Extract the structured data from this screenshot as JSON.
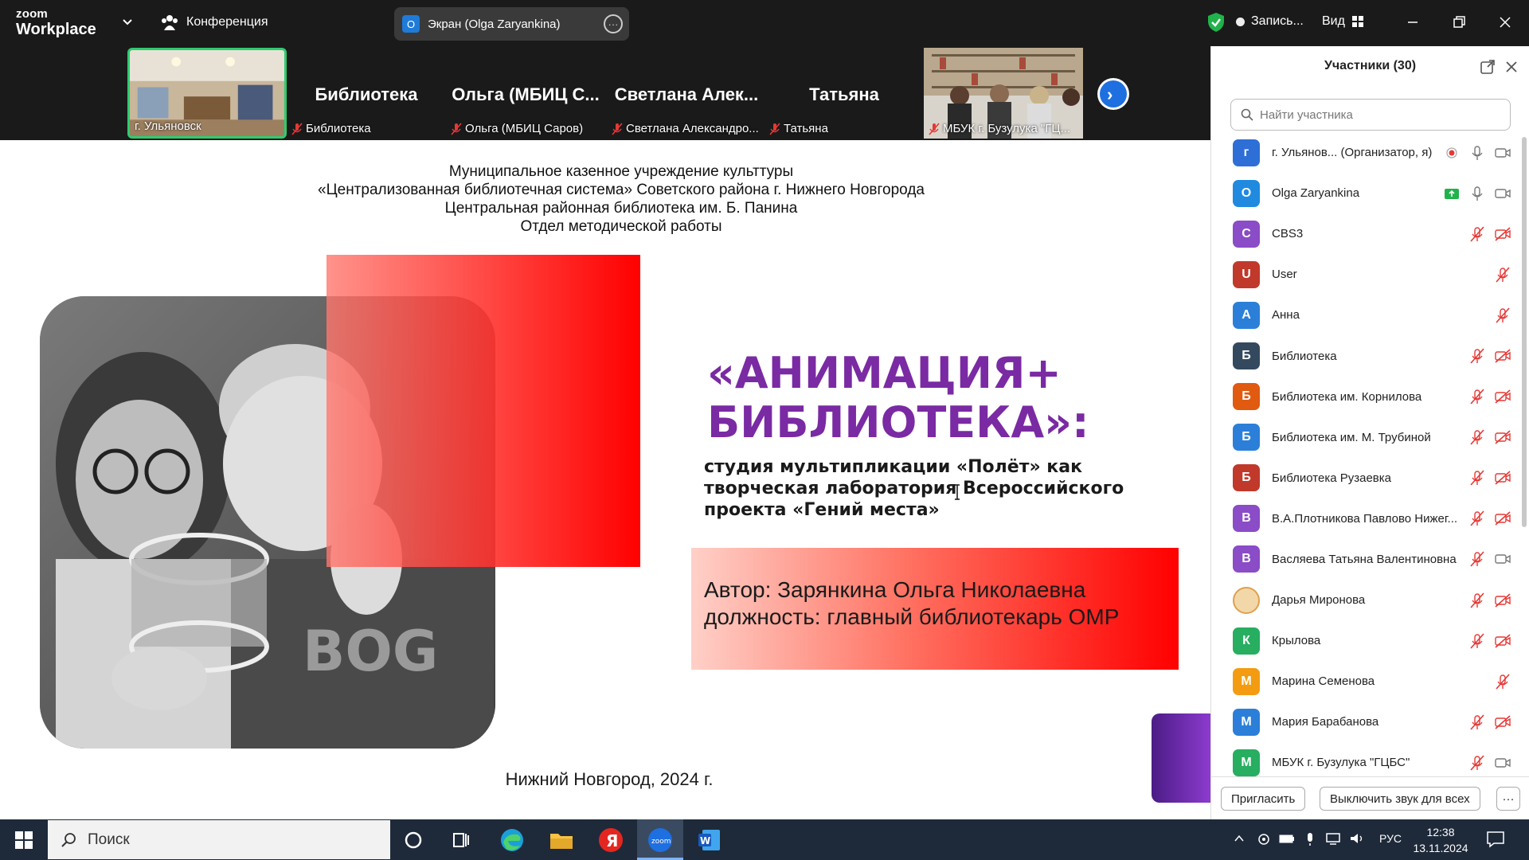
{
  "app": {
    "brand_top": "zoom",
    "brand_bottom": "Workplace",
    "conference_label": "Конференция",
    "screen_label": "Экран (Olga Zaryankina)",
    "screen_badge": "O",
    "record_label": "Запись...",
    "view_label": "Вид"
  },
  "strip": {
    "tiles": [
      {
        "big": "",
        "foot": "г. Ульяновск"
      },
      {
        "big": "Библиотека",
        "foot": "Библиотека"
      },
      {
        "big": "Ольга (МБИЦ С...",
        "foot": "Ольга (МБИЦ Саров)"
      },
      {
        "big": "Светлана Алек...",
        "foot": "Светлана Александро..."
      },
      {
        "big": "Татьяна",
        "foot": "Татьяна"
      },
      {
        "big": "",
        "foot": "МБУК г. Бузулука \"ГЦ..."
      }
    ]
  },
  "slide": {
    "header": [
      "Муниципальное казенное учреждение культтуры",
      "«Централизованная библиотечная система» Советского района г. Нижнего Новгорода",
      "Центральная районная библиотека им. Б. Панина",
      "Отдел методической работы"
    ],
    "title_line1": "«АНИМАЦИЯ+",
    "title_line2": "БИБЛИОТЕКА»:",
    "subtitle_line1": "студия мультипликации «Полёт» как",
    "subtitle_line2": "творческая лаборатория Всероссийского",
    "subtitle_line3": "проекта «Гений места»",
    "author_line1": "Автор: Зарянкина Ольга Николаевна",
    "author_line2": "должность: главный библиотекарь ОМР",
    "city_year": "Нижний Новгород, 2024 г.",
    "colors": {
      "title": "#7a2aa3",
      "accent": "#ff0000"
    }
  },
  "panel": {
    "title": "Участники (30)",
    "search_placeholder": "Найти участника",
    "invite_button": "Пригласить",
    "mute_all_button": "Выключить звук для всех",
    "more_button": "···",
    "participants": [
      {
        "initial": "г",
        "name": "г. Ульянов...  (Организатор, я)",
        "color": "#2d6fd6",
        "icons": "host"
      },
      {
        "initial": "O",
        "name": "Olga Zaryankina",
        "color": "#1f8ae0",
        "icons": "sharing"
      },
      {
        "initial": "C",
        "name": "CBS3",
        "color": "#8a4cc7",
        "icons": "muted-novideo"
      },
      {
        "initial": "U",
        "name": "User",
        "color": "#c0392b",
        "icons": "muted"
      },
      {
        "initial": "А",
        "name": "Анна",
        "color": "#2b7fd8",
        "icons": "muted"
      },
      {
        "initial": "Б",
        "name": "Библиотека",
        "color": "#34495e",
        "icons": "muted-novideo"
      },
      {
        "initial": "Б",
        "name": "Библиотека им. Корнилова",
        "color": "#e05a10",
        "icons": "muted-novideo"
      },
      {
        "initial": "Б",
        "name": "Библиотека им. М. Трубиной",
        "color": "#2b7fd8",
        "icons": "muted-novideo"
      },
      {
        "initial": "Б",
        "name": "Библиотека Рузаевка",
        "color": "#c0392b",
        "icons": "muted-novideo"
      },
      {
        "initial": "В",
        "name": "В.А.Плотникова Павлово Нижег...",
        "color": "#8a4cc7",
        "icons": "muted-novideo"
      },
      {
        "initial": "В",
        "name": "Васляева Татьяна Валентиновна",
        "color": "#8a4cc7",
        "icons": "muted-video"
      },
      {
        "initial": "",
        "name": "Дарья Миронова",
        "color": "#f2d8a8",
        "icons": "muted-novideo"
      },
      {
        "initial": "К",
        "name": "Крылова",
        "color": "#27ae60",
        "icons": "muted-novideo"
      },
      {
        "initial": "М",
        "name": "Марина Семенова",
        "color": "#f39c12",
        "icons": "muted"
      },
      {
        "initial": "М",
        "name": "Мария Барабанова",
        "color": "#2b7fd8",
        "icons": "muted-novideo"
      },
      {
        "initial": "М",
        "name": "МБУК г. Бузулука \"ГЦБС\"",
        "color": "#27ae60",
        "icons": "muted-video"
      }
    ]
  },
  "taskbar": {
    "search_label": "Поиск",
    "lang": "РУС",
    "time": "12:38",
    "date": "13.11.2024"
  }
}
